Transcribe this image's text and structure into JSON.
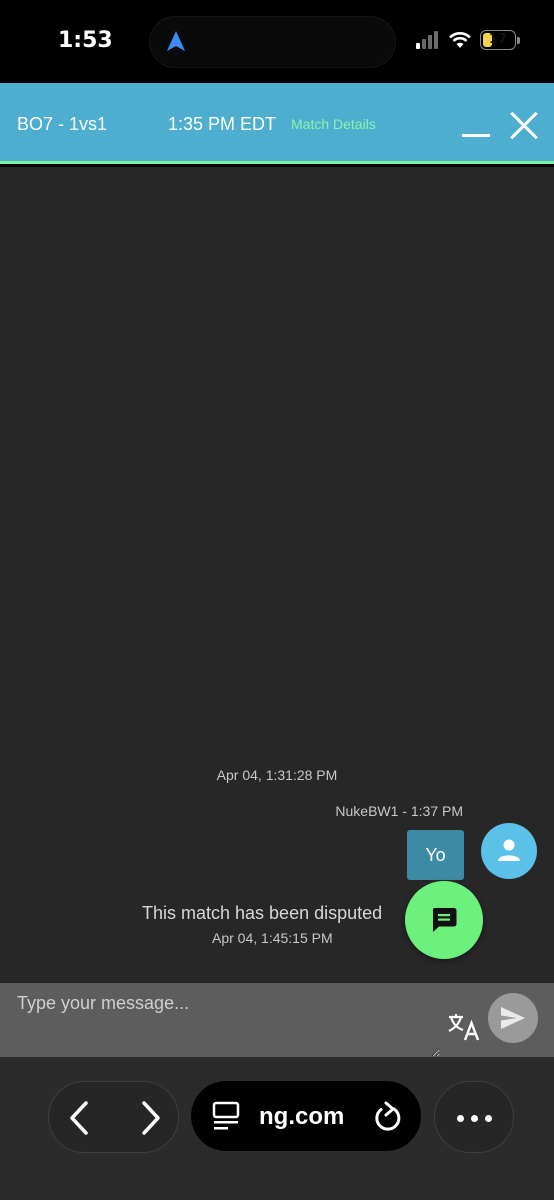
{
  "status_bar": {
    "time": "1:53",
    "battery_level": "17"
  },
  "chat_header": {
    "match_title": "BO7 - 1vs1",
    "match_time": "1:35 PM EDT",
    "match_details_label": "Match Details"
  },
  "chat": {
    "first_timestamp": "Apr 04, 1:31:28 PM",
    "message": {
      "sender": "NukeBW1",
      "time": "1:37 PM",
      "sender_line": "NukeBW1 - 1:37 PM",
      "text": "Yo"
    },
    "system_message": "This match has been disputed",
    "system_timestamp": "Apr 04, 1:45:15 PM"
  },
  "composer": {
    "placeholder": "Type your message..."
  },
  "browser": {
    "url": "ng.com"
  },
  "colors": {
    "header_bg": "#4eaed0",
    "header_accent": "#7cf0a5",
    "match_details": "#8ef2a8",
    "bubble": "#3d8aa5",
    "avatar": "#5bc1e8",
    "chat_fab": "#6cf27c",
    "chat_bg": "#272727",
    "composer_bg": "#5d5d5d"
  }
}
